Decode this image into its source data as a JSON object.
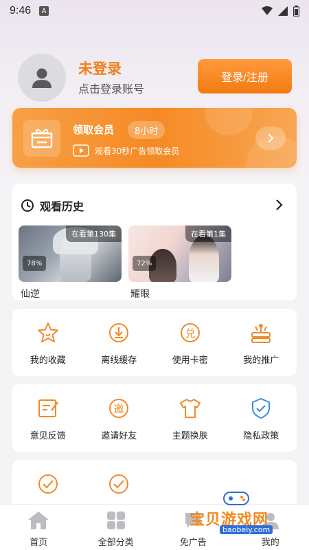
{
  "status_bar": {
    "time": "9:46",
    "a_badge": "A"
  },
  "user": {
    "name": "未登录",
    "subtitle": "点击登录账号",
    "login_button": "登录/注册"
  },
  "vip": {
    "title": "领取会员",
    "badge": "8小时",
    "subtitle": "观看30秒广告领取会员"
  },
  "history": {
    "title": "观看历史",
    "items": [
      {
        "title": "仙逆",
        "episode": "在看第130集",
        "progress": "78%"
      },
      {
        "title": "耀眼",
        "episode": "在看第1集",
        "progress": "72%"
      }
    ]
  },
  "grid_row1": [
    {
      "label": "我的收藏",
      "icon": "star-icon"
    },
    {
      "label": "离线缓存",
      "icon": "download-icon"
    },
    {
      "label": "使用卡密",
      "icon": "redeem-icon"
    },
    {
      "label": "我的推广",
      "icon": "promote-icon"
    }
  ],
  "grid_row2": [
    {
      "label": "意见反馈",
      "icon": "feedback-icon"
    },
    {
      "label": "邀请好友",
      "icon": "invite-icon"
    },
    {
      "label": "主题换肤",
      "icon": "shirt-icon"
    },
    {
      "label": "隐私政策",
      "icon": "shield-icon"
    }
  ],
  "tabs": [
    {
      "label": "首页",
      "icon": "home-icon"
    },
    {
      "label": "全部分类",
      "icon": "category-icon"
    },
    {
      "label": "免广告",
      "icon": "noad-icon"
    },
    {
      "label": "我的",
      "icon": "profile-icon"
    }
  ],
  "watermark": {
    "text": "宝贝游戏网",
    "url": "baobeiy.com"
  },
  "colors": {
    "accent": "#f27b12",
    "accent_light": "#ff9a3c",
    "background": "#f4f4f6"
  }
}
